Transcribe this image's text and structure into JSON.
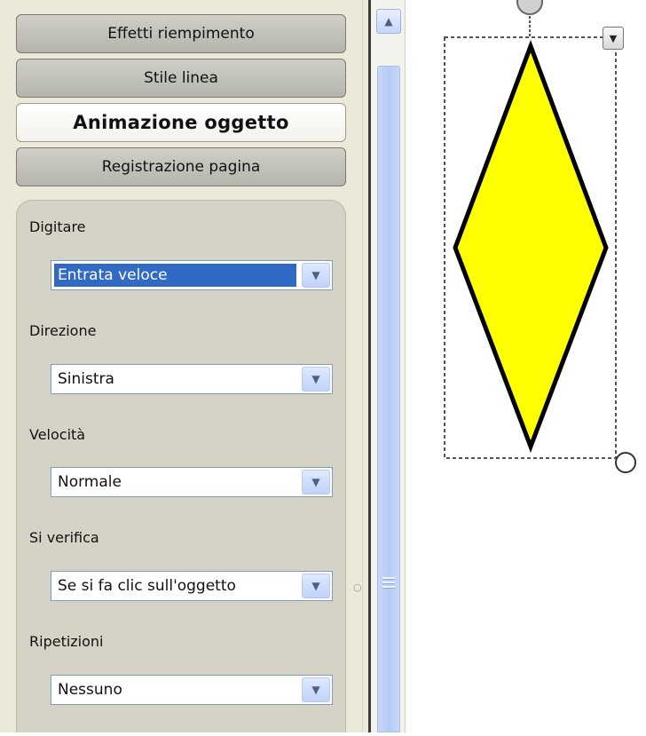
{
  "tabs": [
    {
      "label": "Effetti riempimento",
      "active": false
    },
    {
      "label": "Stile linea",
      "active": false
    },
    {
      "label": "Animazione oggetto",
      "active": true
    },
    {
      "label": "Registrazione pagina",
      "active": false
    }
  ],
  "properties": [
    {
      "label": "Digitare",
      "value": "Entrata veloce",
      "highlighted": true
    },
    {
      "label": "Direzione",
      "value": "Sinistra",
      "highlighted": false
    },
    {
      "label": "Velocità",
      "value": "Normale",
      "highlighted": false
    },
    {
      "label": "Si verifica",
      "value": "Se si fa clic sull'oggetto",
      "highlighted": false
    },
    {
      "label": "Ripetizioni",
      "value": "Nessuno",
      "highlighted": false
    }
  ],
  "icons": {
    "dropdown_arrow": "chevron-down-icon",
    "scroll_up": "chevron-up-icon",
    "object_menu": "triangle-down-icon"
  },
  "colors": {
    "selection": "#316ac5",
    "shape_fill": "#ffff00",
    "shape_stroke": "#000000"
  }
}
